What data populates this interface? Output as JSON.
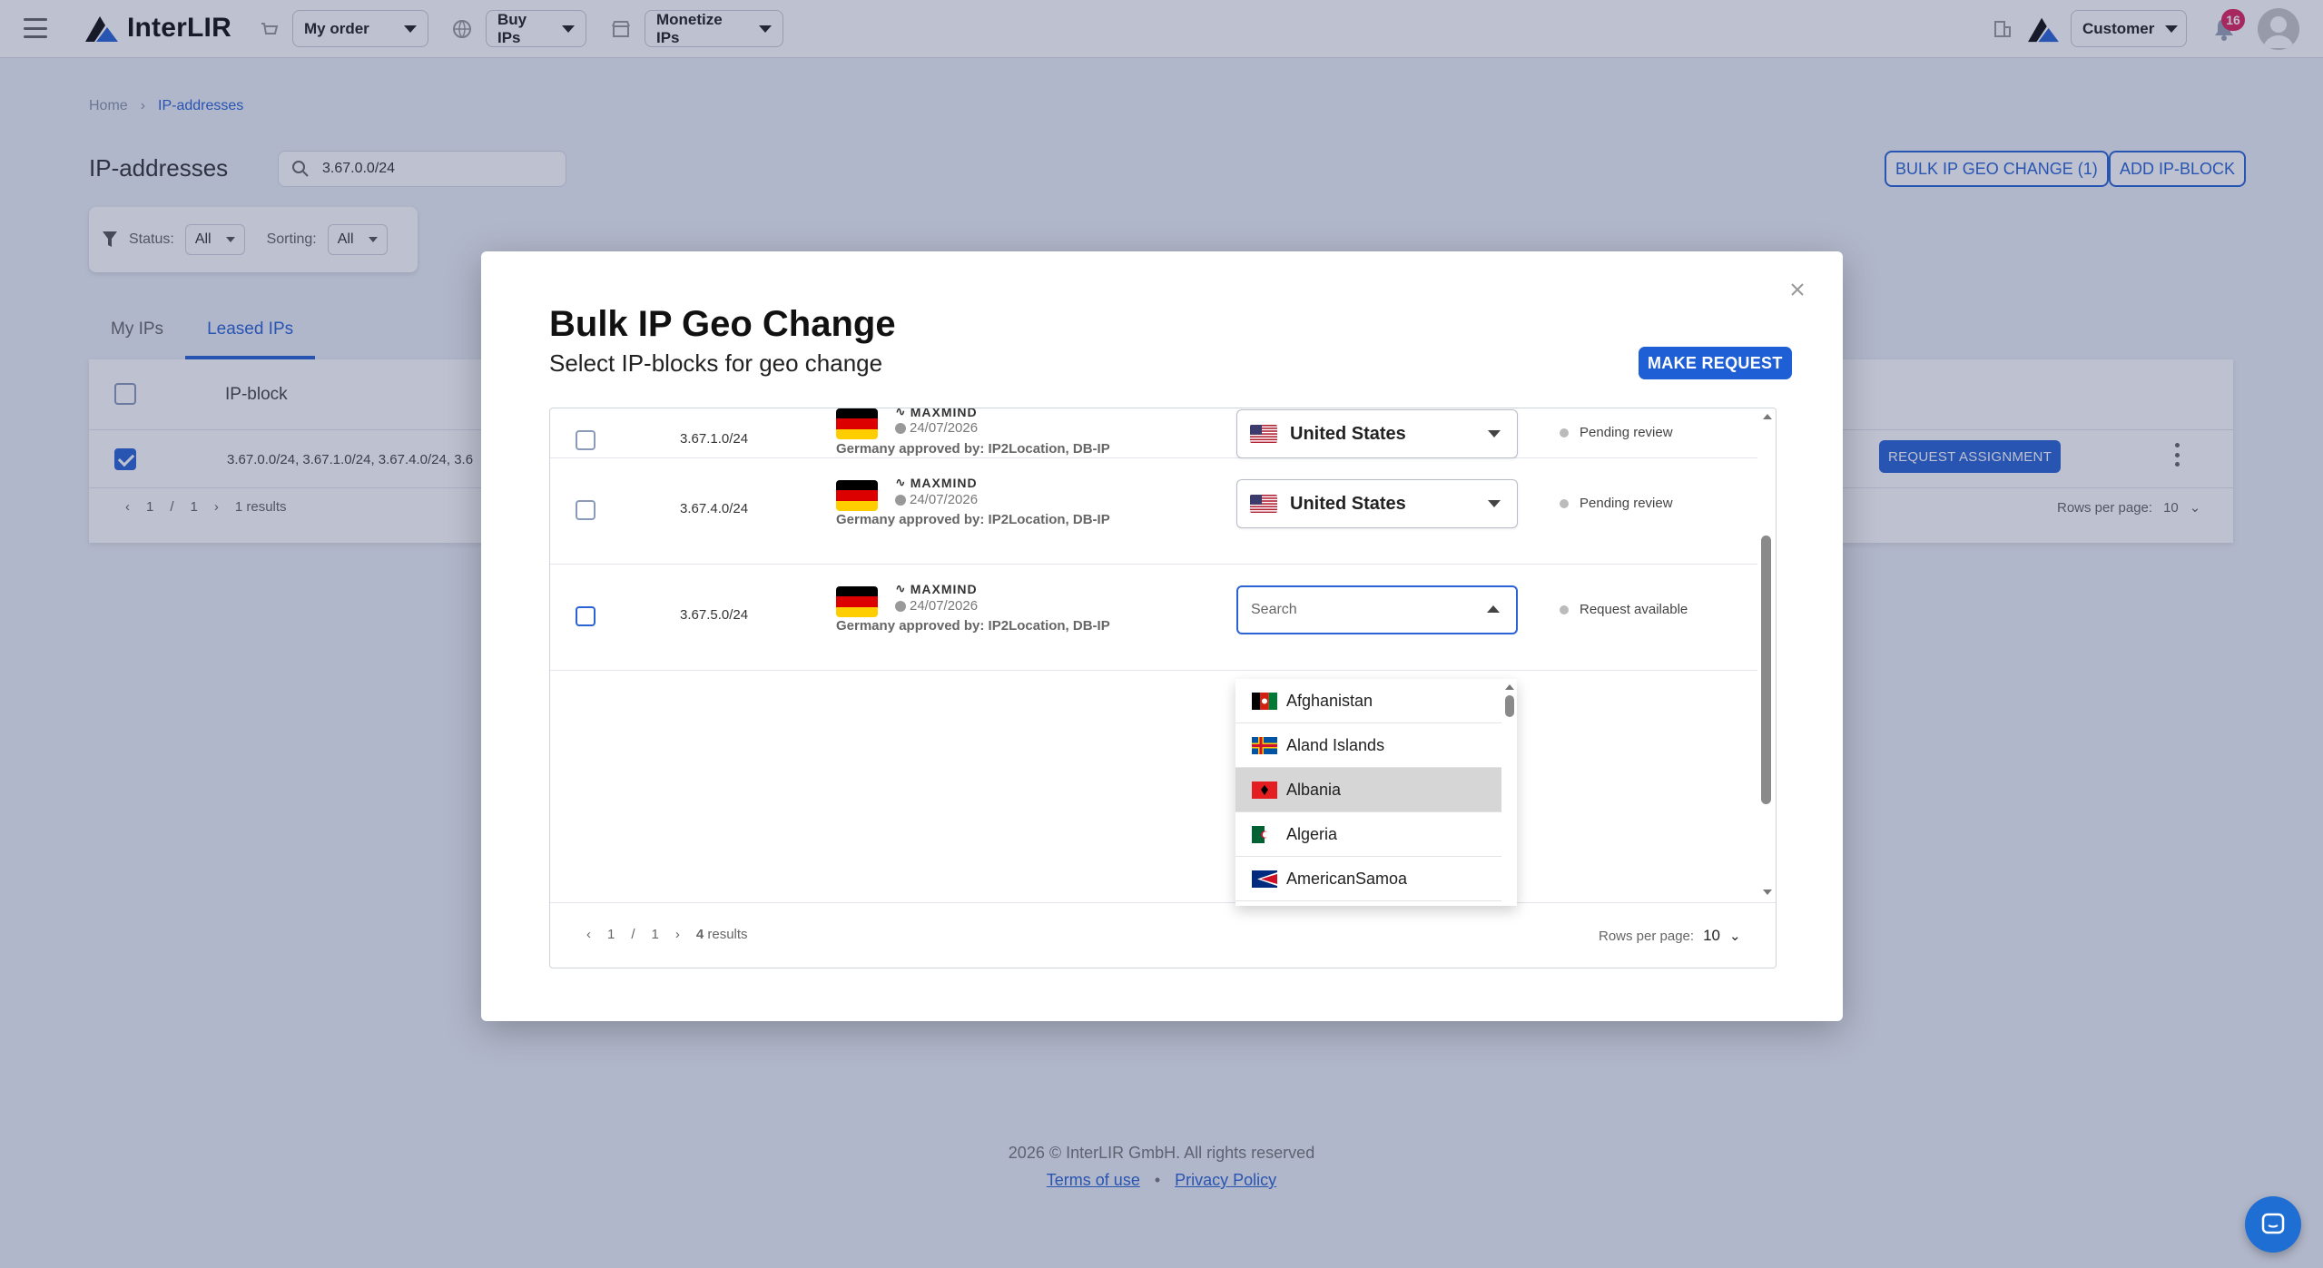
{
  "topbar": {
    "brand": "InterLIR",
    "my_order": "My order",
    "buy_ips": "Buy IPs",
    "monetize_ips": "Monetize IPs",
    "role": "Customer",
    "notifications": "16"
  },
  "breadcrumb": {
    "home": "Home",
    "current": "IP-addresses"
  },
  "page": {
    "title": "IP-addresses",
    "search_value": "3.67.0.0/24",
    "bulk_button": "BULK IP GEO CHANGE (1)",
    "add_button": "ADD IP-BLOCK",
    "filters": {
      "status_label": "Status:",
      "status_value": "All",
      "sorting_label": "Sorting:",
      "sorting_value": "All"
    },
    "tabs": [
      "My IPs",
      "Leased IPs"
    ],
    "table": {
      "col_ipblock": "IP-block",
      "row_ips": "3.67.0.0/24, 3.67.1.0/24, 3.67.4.0/24, 3.6",
      "request_button": "REQUEST ASSIGNMENT",
      "page_current": "1",
      "page_sep": "/",
      "page_total": "1",
      "results": "1 results",
      "rows_label": "Rows per page:",
      "rows_value": "10"
    }
  },
  "modal": {
    "title": "Bulk IP Geo Change",
    "subtitle": "Select IP-blocks for geo change",
    "make_request": "MAKE REQUEST",
    "rows": [
      {
        "ip": "3.67.1.0/24",
        "provider": "MAXMIND",
        "date": "24/07/2026",
        "approved": "Germany approved by: IP2Location, DB-IP",
        "country": "United States",
        "status": "Pending review"
      },
      {
        "ip": "3.67.4.0/24",
        "provider": "MAXMIND",
        "date": "24/07/2026",
        "approved": "Germany approved by: IP2Location, DB-IP",
        "country": "United States",
        "status": "Pending review"
      },
      {
        "ip": "3.67.5.0/24",
        "provider": "MAXMIND",
        "date": "24/07/2026",
        "approved": "Germany approved by: IP2Location, DB-IP",
        "country_placeholder": "Search",
        "status": "Request available"
      }
    ],
    "dropdown_options": [
      "Afghanistan",
      "Aland Islands",
      "Albania",
      "Algeria",
      "AmericanSamoa"
    ],
    "pager": {
      "page_current": "1",
      "page_sep": "/",
      "page_total": "1",
      "results_count": "4",
      "results_word": "results",
      "rows_label": "Rows per page:",
      "rows_value": "10"
    }
  },
  "footer": {
    "copyright": "2026 © InterLIR GmbH. All rights reserved",
    "terms": "Terms of use",
    "bullet": "•",
    "privacy": "Privacy Policy"
  },
  "colors": {
    "accent": "#2a63d4",
    "button": "#1f5fd6",
    "badge": "#e0245e"
  }
}
